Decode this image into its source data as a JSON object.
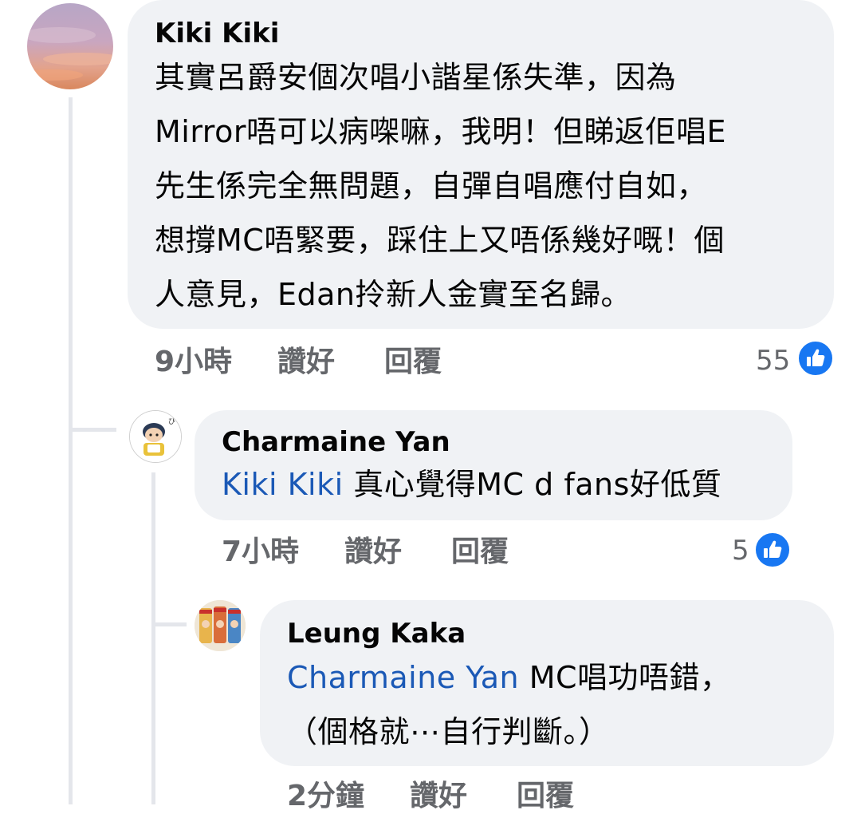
{
  "comments": [
    {
      "author": "Kiki Kiki",
      "lines": [
        "其實呂爵安個次唱小諧星係失準，因為",
        "Mirror唔可以病㗎嘛，我明！但睇返佢唱E",
        "先生係完全無問題，自彈自唱應付自如，",
        "想撐MC唔緊要，踩住上又唔係幾好嘅！個",
        "人意見，Edan拎新人金實至名歸。"
      ],
      "time": "9小時",
      "like_label": "讚好",
      "reply_label": "回覆",
      "reactions": "55"
    },
    {
      "author": "Charmaine Yan",
      "mention": "Kiki Kiki",
      "text": " 真心覺得MC d fans好低質",
      "time": "7小時",
      "like_label": "讚好",
      "reply_label": "回覆",
      "reactions": "5"
    },
    {
      "author": "Leung Kaka",
      "mention": "Charmaine Yan",
      "text": " MC唱功唔錯，",
      "line2": "（個格就⋯自行判斷。）",
      "time": "2分鐘",
      "like_label": "讚好",
      "reply_label": "回覆"
    }
  ],
  "colors": {
    "bubble": "#f0f2f5",
    "mention": "#1b59b6",
    "like_blue": "#1877f2",
    "meta": "#65676b"
  },
  "icons": [
    "like-reaction-icon"
  ]
}
